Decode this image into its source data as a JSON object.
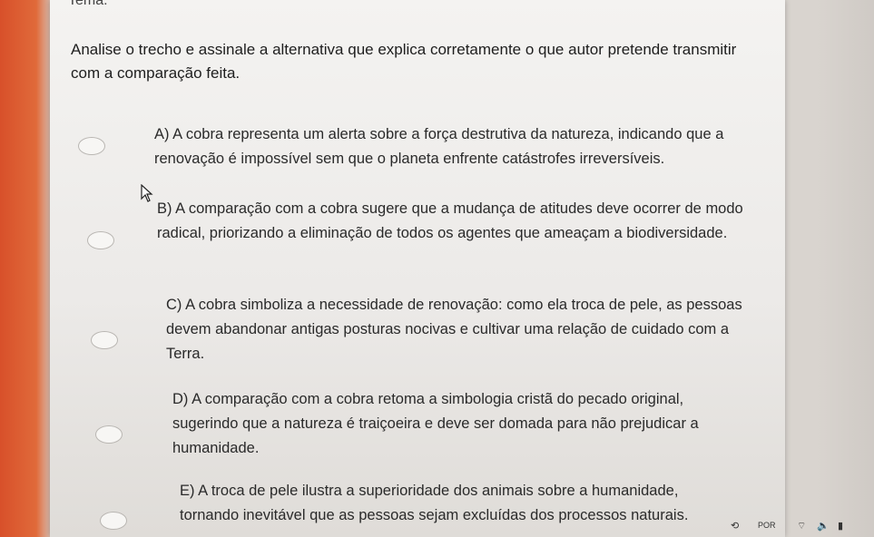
{
  "header": {
    "label": "Tema:"
  },
  "question": {
    "text": "Analise o trecho e assinale a alternativa que explica corretamente o que autor pretende transmitir com a comparação feita."
  },
  "options": [
    {
      "text": "A) A cobra representa um alerta sobre a força destrutiva da natureza, indicando que a renovação é impossível sem que o planeta enfrente catástrofes irreversíveis."
    },
    {
      "text": "B) A comparação com a cobra sugere que a mudança de atitudes deve ocorrer de modo radical, priorizando a eliminação de todos os agentes que ameaçam a biodiversidade."
    },
    {
      "text": "C) A cobra simboliza a necessidade de renovação: como ela troca de pele, as pessoas devem abandonar antigas posturas nocivas e cultivar uma relação de cuidado com a Terra."
    },
    {
      "text": "D) A comparação com a cobra retoma a simbologia cristã do pecado original, sugerindo que a natureza é traiçoeira e deve ser domada para não prejudicar a humanidade."
    },
    {
      "text": "E) A troca de pele ilustra a superioridade dos animais sobre a humanidade, tornando inevitável que as pessoas sejam excluídas dos processos naturais."
    }
  ],
  "taskbar": {
    "language": "POR",
    "icons": [
      "wifi-icon",
      "volume-icon",
      "battery-icon"
    ]
  }
}
